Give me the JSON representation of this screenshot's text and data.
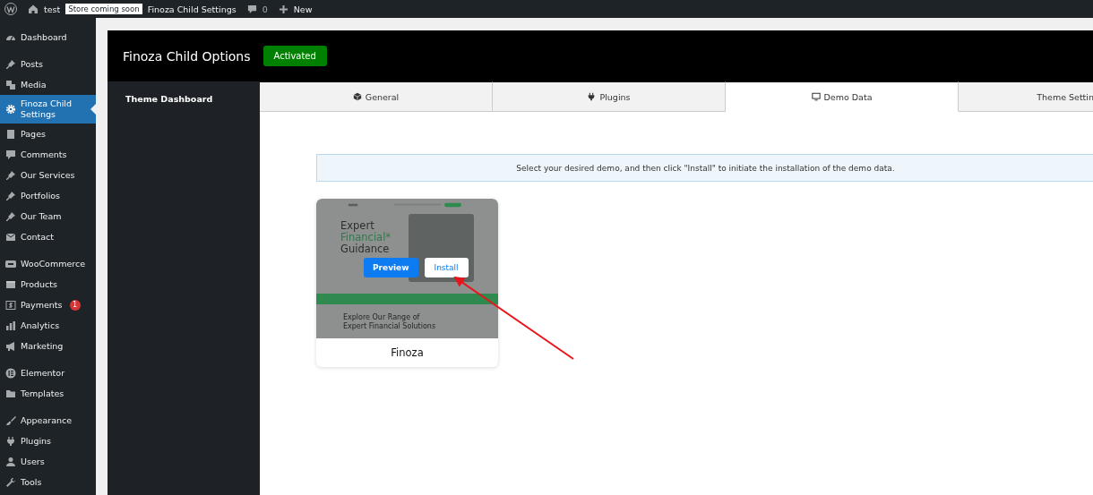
{
  "admin_bar": {
    "site": "test",
    "badge": "Store coming soon",
    "page": "Finoza Child Settings",
    "comments": "0",
    "new": "New"
  },
  "sidebar": {
    "groups": [
      [
        {
          "label": "Dashboard",
          "selected": false
        }
      ],
      [
        {
          "label": "Posts",
          "selected": false
        },
        {
          "label": "Media",
          "selected": false
        },
        {
          "label": "Finoza Child Settings",
          "selected": true
        },
        {
          "label": "Pages",
          "selected": false
        },
        {
          "label": "Comments",
          "selected": false
        },
        {
          "label": "Our Services",
          "selected": false
        },
        {
          "label": "Portfolios",
          "selected": false
        },
        {
          "label": "Our Team",
          "selected": false
        },
        {
          "label": "Contact",
          "selected": false
        }
      ],
      [
        {
          "label": "WooCommerce",
          "selected": false
        },
        {
          "label": "Products",
          "selected": false
        },
        {
          "label": "Payments",
          "selected": false,
          "badge": "1"
        },
        {
          "label": "Analytics",
          "selected": false
        },
        {
          "label": "Marketing",
          "selected": false
        }
      ],
      [
        {
          "label": "Elementor",
          "selected": false
        },
        {
          "label": "Templates",
          "selected": false
        }
      ],
      [
        {
          "label": "Appearance",
          "selected": false
        },
        {
          "label": "Plugins",
          "selected": false
        },
        {
          "label": "Users",
          "selected": false
        },
        {
          "label": "Tools",
          "selected": false
        }
      ]
    ]
  },
  "panel": {
    "title": "Finoza Child Options",
    "status": "Activated",
    "nav": [
      "Theme Dashboard"
    ]
  },
  "tabs": [
    {
      "label": "General",
      "selected": false
    },
    {
      "label": "Plugins",
      "selected": false
    },
    {
      "label": "Demo Data",
      "selected": true
    },
    {
      "label": "Theme Settin",
      "selected": false
    }
  ],
  "notice": "Select your desired demo, and then click \"Install\" to initiate the installation of the demo data.",
  "demos": [
    {
      "name": "Finoza",
      "headline": [
        "Expert",
        "Financial*",
        "Guidance"
      ],
      "subhead": [
        "Explore Our Range of",
        "Expert Financial Solutions"
      ],
      "buttons": [
        {
          "label": "Preview",
          "kind": "primary"
        },
        {
          "label": "Install",
          "kind": "secondary"
        }
      ]
    }
  ]
}
